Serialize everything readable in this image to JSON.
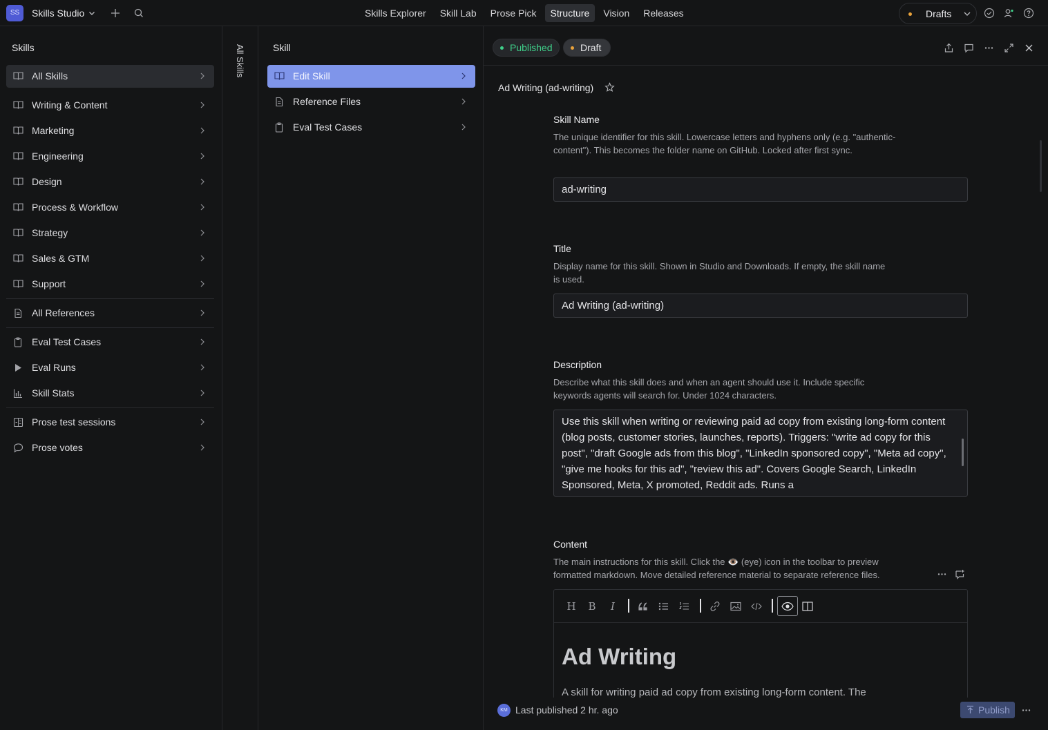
{
  "app": {
    "logo_text": "SS",
    "name": "Skills Studio"
  },
  "nav": [
    {
      "label": "Skills Explorer",
      "active": false
    },
    {
      "label": "Skill Lab",
      "active": false
    },
    {
      "label": "Prose Pick",
      "active": false
    },
    {
      "label": "Structure",
      "active": true
    },
    {
      "label": "Vision",
      "active": false
    },
    {
      "label": "Releases",
      "active": false
    }
  ],
  "branch": {
    "label": "Drafts",
    "dot_color": "#e9a23b"
  },
  "skills_panel": {
    "title": "Skills",
    "items": [
      {
        "label": "All Skills",
        "icon": "book-icon",
        "active": true
      },
      {
        "label": "Writing & Content",
        "icon": "book-icon"
      },
      {
        "label": "Marketing",
        "icon": "book-icon"
      },
      {
        "label": "Engineering",
        "icon": "book-icon"
      },
      {
        "label": "Design",
        "icon": "book-icon"
      },
      {
        "label": "Process & Workflow",
        "icon": "book-icon"
      },
      {
        "label": "Strategy",
        "icon": "book-icon"
      },
      {
        "label": "Sales & GTM",
        "icon": "book-icon"
      },
      {
        "label": "Support",
        "icon": "book-icon"
      },
      {
        "label": "All References",
        "icon": "file-icon"
      },
      {
        "label": "Eval Test Cases",
        "icon": "clipboard-icon"
      },
      {
        "label": "Eval Runs",
        "icon": "play-icon"
      },
      {
        "label": "Skill Stats",
        "icon": "bar-chart-icon"
      },
      {
        "label": "Prose test sessions",
        "icon": "session-icon"
      },
      {
        "label": "Prose votes",
        "icon": "comment-icon"
      }
    ]
  },
  "collapsed_panel": {
    "title": "All Skills"
  },
  "skill_panel": {
    "title": "Skill",
    "items": [
      {
        "label": "Edit Skill",
        "icon": "book-icon",
        "active": true
      },
      {
        "label": "Reference Files",
        "icon": "file-icon"
      },
      {
        "label": "Eval Test Cases",
        "icon": "clipboard-icon"
      }
    ]
  },
  "detail": {
    "status_published": "Published",
    "status_draft": "Draft",
    "published_color": "#3fd08a",
    "draft_color": "#e9a23b",
    "doc_title": "Ad Writing (ad-writing)",
    "skill_name": {
      "label": "Skill Name",
      "help": "The unique identifier for this skill. Lowercase letters and hyphens only (e.g. \"authentic-content\"). This becomes the folder name on GitHub. Locked after first sync.",
      "value": "ad-writing"
    },
    "title": {
      "label": "Title",
      "help": "Display name for this skill. Shown in Studio and Downloads. If empty, the skill name is used.",
      "value": "Ad Writing (ad-writing)"
    },
    "description": {
      "label": "Description",
      "help": "Describe what this skill does and when an agent should use it. Include specific keywords agents will search for. Under 1024 characters.",
      "value": "Use this skill when writing or reviewing paid ad copy from existing long-form content (blog posts, customer stories, launches, reports). Triggers: \"write ad copy for this post\", \"draft Google ads from this blog\", \"LinkedIn sponsored copy\", \"Meta ad copy\", \"give me hooks for this ad\", \"review this ad\". Covers Google Search, LinkedIn Sponsored, Meta, X promoted, Reddit ads. Runs a"
    },
    "content": {
      "label": "Content",
      "help": "The main instructions for this skill. Click the 👁️ (eye) icon in the toolbar to preview formatted markdown. Move detailed reference material to separate reference files.",
      "heading": "Ad Writing",
      "paragraph": "A skill for writing paid ad copy from existing long-form content. The"
    },
    "toolbar": {
      "heading": "H",
      "bold": "B",
      "italic": "I"
    },
    "footer": {
      "avatar_initials": "KM",
      "last_published": "Last published 2 hr. ago",
      "publish_label": "Publish"
    }
  }
}
